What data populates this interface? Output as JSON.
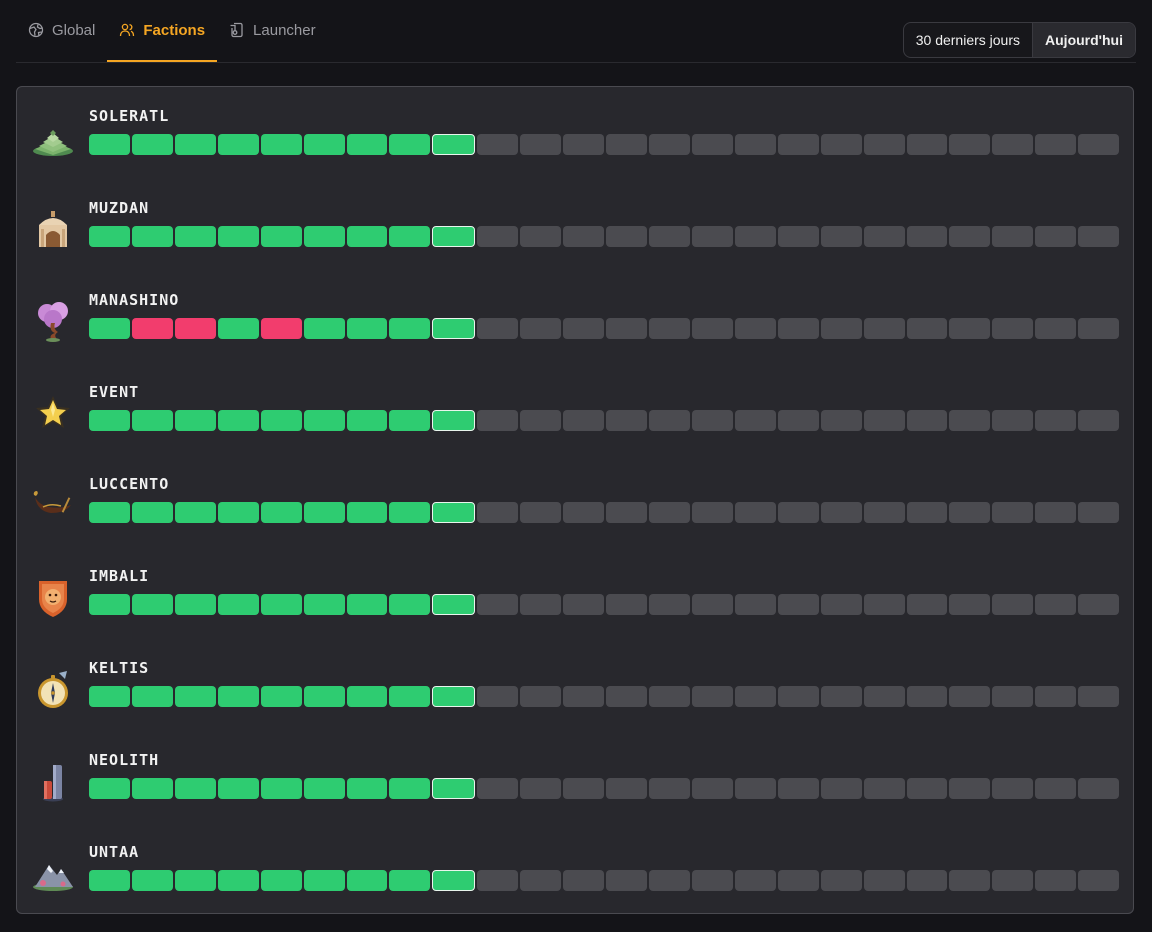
{
  "tabs": [
    {
      "label": "Global",
      "icon": "globe-icon",
      "active": false
    },
    {
      "label": "Factions",
      "icon": "users-icon",
      "active": true
    },
    {
      "label": "Launcher",
      "icon": "launcher-icon",
      "active": false
    }
  ],
  "range": {
    "options": [
      "30 derniers jours",
      "Aujourd'hui"
    ],
    "selected": "Aujourd'hui"
  },
  "colors": {
    "accent": "#f5a623",
    "up": "#2ecc71",
    "down": "#f23d6d",
    "empty": "#4b4b50"
  },
  "segments_total": 24,
  "current_segment_index": 8,
  "factions": [
    {
      "name": "SOLERATL",
      "icon": "pyramid-icon",
      "statuses": [
        "up",
        "up",
        "up",
        "up",
        "up",
        "up",
        "up",
        "up",
        "up"
      ]
    },
    {
      "name": "MUZDAN",
      "icon": "palace-icon",
      "statuses": [
        "up",
        "up",
        "up",
        "up",
        "up",
        "up",
        "up",
        "up",
        "up"
      ]
    },
    {
      "name": "MANASHINO",
      "icon": "blossom-tree-icon",
      "statuses": [
        "up",
        "down",
        "down",
        "up",
        "down",
        "up",
        "up",
        "up",
        "up"
      ]
    },
    {
      "name": "EVENT",
      "icon": "star-icon",
      "statuses": [
        "up",
        "up",
        "up",
        "up",
        "up",
        "up",
        "up",
        "up",
        "up"
      ]
    },
    {
      "name": "LUCCENTO",
      "icon": "gondola-icon",
      "statuses": [
        "up",
        "up",
        "up",
        "up",
        "up",
        "up",
        "up",
        "up",
        "up"
      ]
    },
    {
      "name": "IMBALI",
      "icon": "lion-shield-icon",
      "statuses": [
        "up",
        "up",
        "up",
        "up",
        "up",
        "up",
        "up",
        "up",
        "up"
      ]
    },
    {
      "name": "KELTIS",
      "icon": "compass-icon",
      "statuses": [
        "up",
        "up",
        "up",
        "up",
        "up",
        "up",
        "up",
        "up",
        "up"
      ]
    },
    {
      "name": "NEOLITH",
      "icon": "monolith-icon",
      "statuses": [
        "up",
        "up",
        "up",
        "up",
        "up",
        "up",
        "up",
        "up",
        "up"
      ]
    },
    {
      "name": "UNTAA",
      "icon": "mountain-icon",
      "statuses": [
        "up",
        "up",
        "up",
        "up",
        "up",
        "up",
        "up",
        "up",
        "up"
      ]
    }
  ]
}
